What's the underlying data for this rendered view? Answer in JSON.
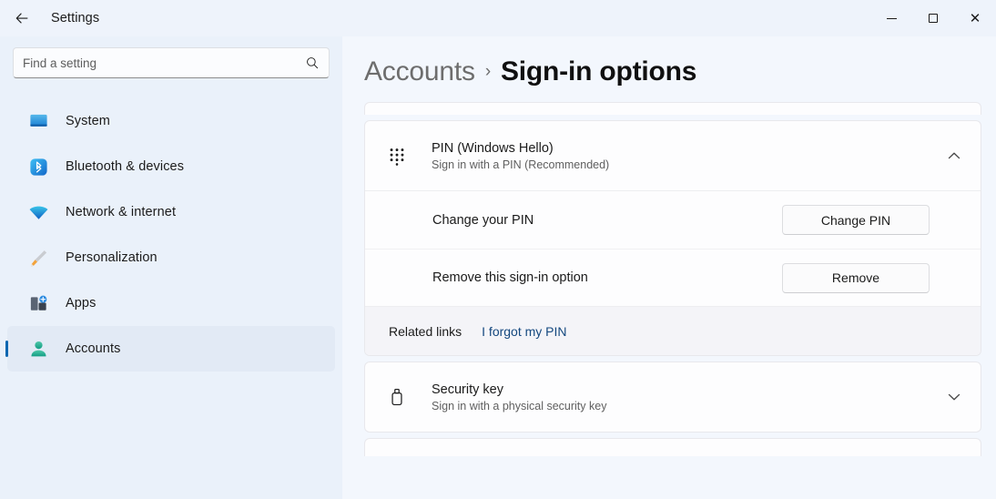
{
  "titlebar": {
    "back_icon": "back-arrow-icon",
    "title": "Settings",
    "minimize_label": "Minimize",
    "maximize_label": "Maximize",
    "close_label": "Close",
    "close_glyph": "✕"
  },
  "sidebar": {
    "search": {
      "placeholder": "Find a setting",
      "value": "",
      "icon": "search-icon"
    },
    "items": [
      {
        "label": "System",
        "icon": "monitor-icon",
        "selected": false
      },
      {
        "label": "Bluetooth & devices",
        "icon": "bluetooth-icon",
        "selected": false
      },
      {
        "label": "Network & internet",
        "icon": "wifi-icon",
        "selected": false
      },
      {
        "label": "Personalization",
        "icon": "paintbrush-icon",
        "selected": false
      },
      {
        "label": "Apps",
        "icon": "apps-icon",
        "selected": false
      },
      {
        "label": "Accounts",
        "icon": "person-icon",
        "selected": true
      }
    ]
  },
  "header": {
    "parent": "Accounts",
    "separator": "›",
    "current": "Sign-in options"
  },
  "main": {
    "pin_section": {
      "icon": "keypad-icon",
      "title": "PIN (Windows Hello)",
      "subtitle": "Sign in with a PIN (Recommended)",
      "expanded": true,
      "chevron": "chevron-up-icon",
      "rows": [
        {
          "label": "Change your PIN",
          "button": "Change PIN"
        },
        {
          "label": "Remove this sign-in option",
          "button": "Remove"
        }
      ],
      "related": {
        "label": "Related links",
        "link": "I forgot my PIN"
      }
    },
    "security_key_section": {
      "icon": "security-key-icon",
      "title": "Security key",
      "subtitle": "Sign in with a physical security key",
      "expanded": false,
      "chevron": "chevron-down-icon"
    }
  },
  "colors": {
    "accent": "#0f67b1",
    "link": "#14487f",
    "sidebar_bg": "#eaf1fa",
    "content_bg": "#f3f7fd",
    "card_bg": "#fdfdfe",
    "selected_bg": "#e2eaf5"
  }
}
